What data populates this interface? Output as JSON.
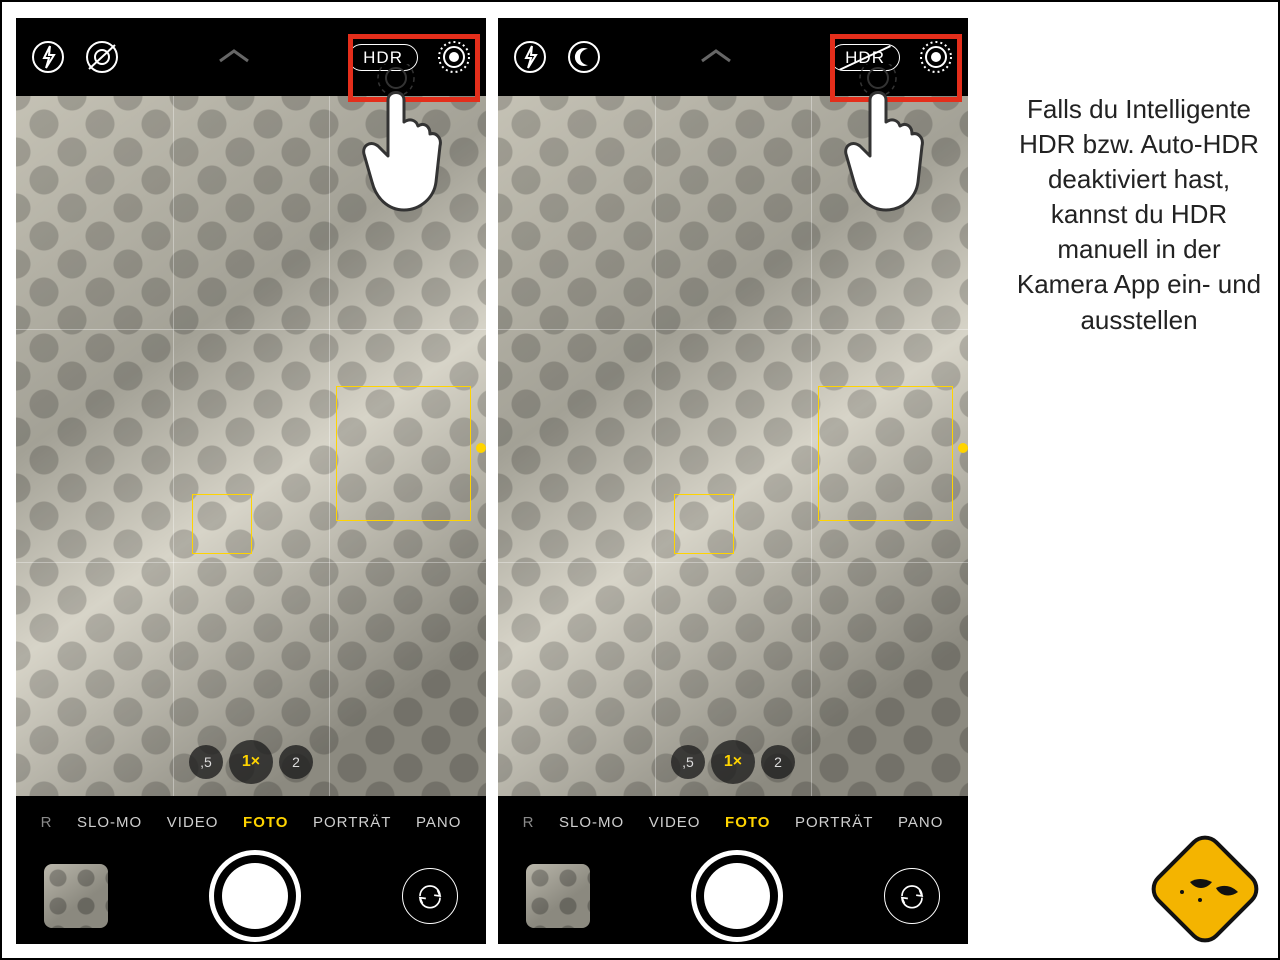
{
  "sidebar": {
    "text": "Falls du Intelligente HDR bzw. Auto-HDR deaktiviert hast, kannst du HDR manuell in der Kamera App ein- und ausstellen"
  },
  "screens": [
    {
      "hdr_label": "HDR",
      "hdr_struck": false,
      "zoom": {
        "options": [
          ",5",
          "1×",
          "2"
        ],
        "active_index": 1
      },
      "modes": {
        "truncated_left": "R",
        "items": [
          "SLO-MO",
          "VIDEO",
          "FOTO",
          "PORTRÄT",
          "PANO"
        ],
        "active_index": 2
      }
    },
    {
      "hdr_label": "HDR",
      "hdr_struck": true,
      "zoom": {
        "options": [
          ",5",
          "1×",
          "2"
        ],
        "active_index": 1
      },
      "modes": {
        "truncated_left": "R",
        "items": [
          "SLO-MO",
          "VIDEO",
          "FOTO",
          "PORTRÄT",
          "PANO"
        ],
        "active_index": 2
      }
    }
  ],
  "colors": {
    "highlight": "#e42e1b",
    "accent": "#ffd400"
  }
}
